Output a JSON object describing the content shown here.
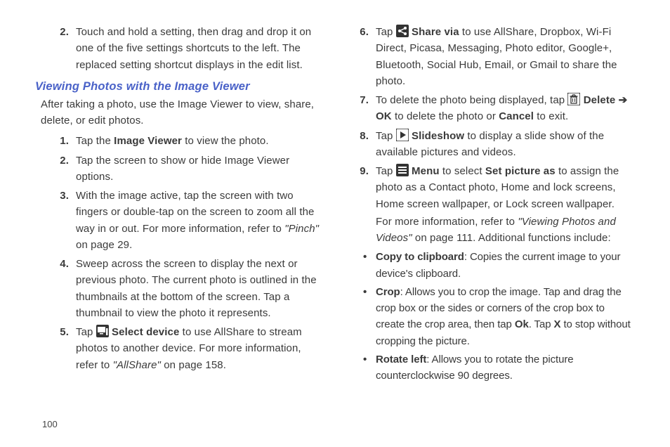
{
  "page_number": "100",
  "left": {
    "top_step": {
      "num": "2.",
      "text": "Touch and hold a setting, then drag and drop it on one of the five settings shortcuts to the left. The replaced setting shortcut displays in the edit list."
    },
    "heading": "Viewing Photos with the Image Viewer",
    "intro": "After taking a photo, use the Image Viewer to view, share, delete, or edit photos.",
    "steps": [
      {
        "num": "1.",
        "pre": "Tap the ",
        "bold": "Image Viewer",
        "post": " to view the photo."
      },
      {
        "num": "2.",
        "text": "Tap the screen to show or hide Image Viewer options."
      },
      {
        "num": "3.",
        "text_a": "With the image active, tap the screen with two fingers or double-tap on the screen to zoom all the way in or out. For more information, refer to ",
        "ref": "\"Pinch\"",
        "text_b": "  on page 29."
      },
      {
        "num": "4.",
        "text": "Sweep across the screen to display the next or previous photo. The current photo is outlined in the thumbnails at the bottom of the screen. Tap a thumbnail to view the photo it represents."
      },
      {
        "num": "5.",
        "pre": "Tap ",
        "bold": " Select device",
        "post": " to use AllShare to stream photos to another device. For more information, refer to ",
        "ref": "\"AllShare\"",
        "tail": "  on page 158."
      }
    ]
  },
  "right": {
    "steps": [
      {
        "num": "6.",
        "pre": "Tap ",
        "bold": " Share via",
        "post": " to use AllShare, Dropbox, Wi-Fi Direct, Picasa, Messaging, Photo editor, Google+, Bluetooth, Social Hub, Email, or Gmail to share the photo."
      },
      {
        "num": "7.",
        "pre": "To delete the photo being displayed, tap ",
        "bold": " Delete ",
        "arrow": "➔",
        "line2_bold_a": "OK",
        "line2_mid": " to delete the photo or ",
        "line2_bold_b": "Cancel",
        "line2_end": " to exit."
      },
      {
        "num": "8.",
        "pre": "Tap ",
        "bold": " Slideshow",
        "post": " to display a slide show of the available pictures and videos."
      },
      {
        "num": "9.",
        "pre": "Tap ",
        "bold_a": " Menu",
        "mid_a": " to select ",
        "bold_b": "Set picture as",
        "post": " to assign the photo as a Contact photo, Home and lock screens, Home screen wallpaper, or Lock screen wallpaper.",
        "line2_pre": "For more information, refer to ",
        "ref": "\"Viewing Photos and Videos\"",
        "line2_post": "  on page 111. Additional functions include:"
      }
    ],
    "bullets": [
      {
        "bold": "Copy to clipboard",
        "text": ": Copies the current image to your device's clipboard."
      },
      {
        "bold": "Crop",
        "text_a": ": Allows you to crop the image. Tap and drag the crop box or the sides or corners of the crop box to create the crop area, then tap ",
        "bold_b": "Ok",
        "text_b": ". Tap ",
        "bold_c": "X",
        "text_c": " to stop without cropping the picture."
      },
      {
        "bold": "Rotate left",
        "text": ": Allows you to rotate the picture counterclockwise 90 degrees."
      }
    ]
  }
}
